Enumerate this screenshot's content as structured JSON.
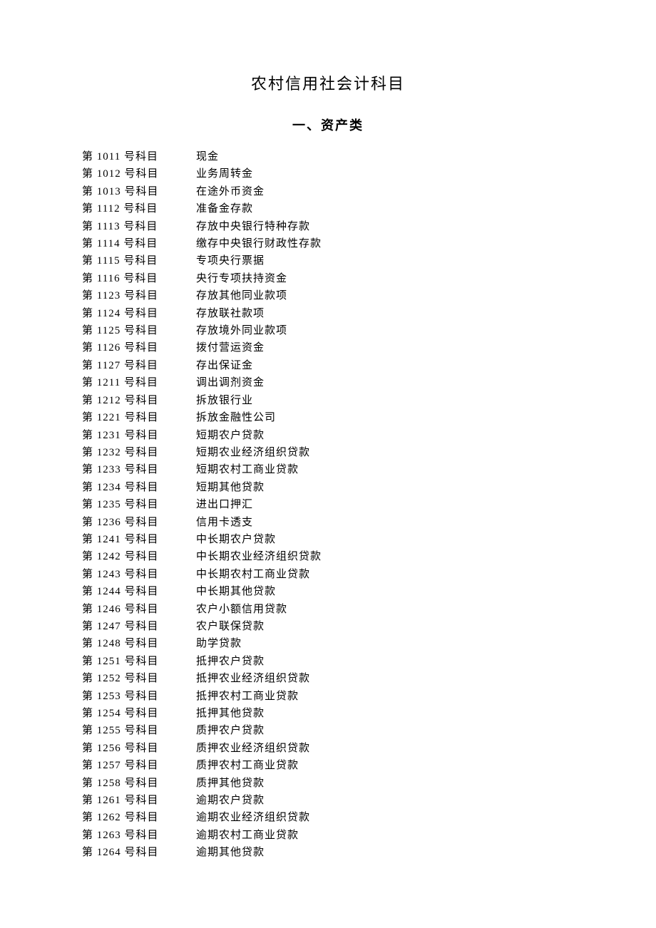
{
  "title": "农村信用社会计科目",
  "subtitle": "一、资产类",
  "rows": [
    {
      "code": "第 1011 号科目",
      "name": "现金"
    },
    {
      "code": "第 1012 号科目",
      "name": "业务周转金"
    },
    {
      "code": "第 1013 号科目",
      "name": "在途外币资金"
    },
    {
      "code": "第 1112 号科目",
      "name": "准备金存款"
    },
    {
      "code": "第 1113 号科目",
      "name": "存放中央银行特种存款"
    },
    {
      "code": "第 1114 号科目",
      "name": "缴存中央银行财政性存款"
    },
    {
      "code": "第 1115 号科目",
      "name": "专项央行票据"
    },
    {
      "code": "第 1116 号科目",
      "name": "央行专项扶持资金"
    },
    {
      "code": "第 1123 号科目",
      "name": "存放其他同业款项"
    },
    {
      "code": "第 1124 号科目",
      "name": "存放联社款项"
    },
    {
      "code": "第 1125 号科目",
      "name": "存放境外同业款项"
    },
    {
      "code": "第 1126 号科目",
      "name": "拨付营运资金"
    },
    {
      "code": "第 1127 号科目",
      "name": "存出保证金"
    },
    {
      "code": "第 1211 号科目",
      "name": "调出调剂资金"
    },
    {
      "code": "第 1212 号科目",
      "name": "拆放银行业"
    },
    {
      "code": "第 1221 号科目",
      "name": "拆放金融性公司"
    },
    {
      "code": "第 1231 号科目",
      "name": "短期农户贷款"
    },
    {
      "code": "第 1232 号科目",
      "name": "短期农业经济组织贷款"
    },
    {
      "code": "第 1233 号科目",
      "name": "短期农村工商业贷款"
    },
    {
      "code": "第 1234 号科目",
      "name": "短期其他贷款"
    },
    {
      "code": "第 1235 号科目",
      "name": "进出口押汇"
    },
    {
      "code": "第 1236 号科目",
      "name": "信用卡透支"
    },
    {
      "code": "第 1241 号科目",
      "name": "中长期农户贷款"
    },
    {
      "code": "第 1242 号科目",
      "name": "中长期农业经济组织贷款"
    },
    {
      "code": "第 1243 号科目",
      "name": "中长期农村工商业贷款"
    },
    {
      "code": "第 1244 号科目",
      "name": "中长期其他贷款"
    },
    {
      "code": "第 1246 号科目",
      "name": "农户小额信用贷款"
    },
    {
      "code": "第 1247 号科目",
      "name": "农户联保贷款"
    },
    {
      "code": "第 1248 号科目",
      "name": "助学贷款"
    },
    {
      "code": "第 1251 号科目",
      "name": "抵押农户贷款"
    },
    {
      "code": "第 1252 号科目",
      "name": "抵押农业经济组织贷款"
    },
    {
      "code": "第 1253 号科目",
      "name": "抵押农村工商业贷款"
    },
    {
      "code": "第 1254 号科目",
      "name": "抵押其他贷款"
    },
    {
      "code": "第 1255 号科目",
      "name": "质押农户贷款"
    },
    {
      "code": "第 1256 号科目",
      "name": "质押农业经济组织贷款"
    },
    {
      "code": "第 1257 号科目",
      "name": "质押农村工商业贷款"
    },
    {
      "code": "第 1258 号科目",
      "name": "质押其他贷款"
    },
    {
      "code": "第 1261 号科目",
      "name": "逾期农户贷款"
    },
    {
      "code": "第 1262 号科目",
      "name": "逾期农业经济组织贷款"
    },
    {
      "code": "第 1263 号科目",
      "name": "逾期农村工商业贷款"
    },
    {
      "code": "第 1264 号科目",
      "name": "逾期其他贷款"
    }
  ]
}
